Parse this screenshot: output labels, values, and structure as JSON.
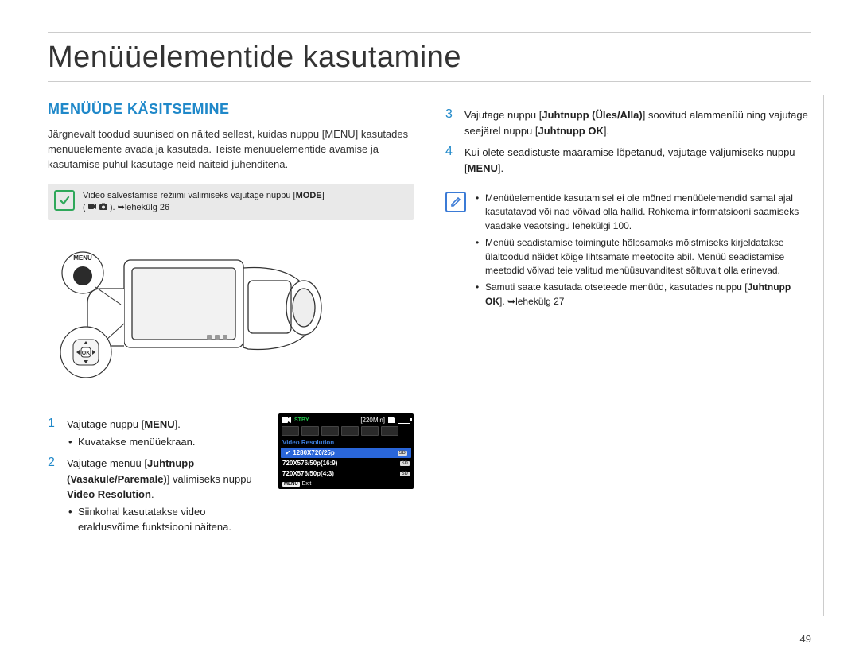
{
  "page": {
    "title": "Menüüelementide kasutamine",
    "number": "49"
  },
  "left": {
    "subhead": "MENÜÜDE KÄSITSEMINE",
    "intro": "Järgnevalt toodud suunised on näited sellest, kuidas nuppu [MENU] kasutades menüüelemente avada ja kasutada. Teiste menüüelementide avamise ja kasutamise puhul kasutage neid näiteid juhenditena.",
    "note": {
      "text_a": "Video salvestamise režiimi valimiseks vajutage nuppu [",
      "mode": "MODE",
      "text_b": "]",
      "page_ref": "lehekülg 26"
    },
    "camera_labels": {
      "menu": "MENU",
      "ok": "OK"
    },
    "steps": {
      "s1": {
        "num": "1",
        "line": "Vajutage nuppu [MENU].",
        "bullet": "Kuvatakse menüüekraan."
      },
      "s2": {
        "num": "2",
        "line_a": "Vajutage menüü [",
        "ctrl": "Juhtnupp (Vasakule/Paremale)",
        "line_b": "] valimiseks nuppu ",
        "target": "Video Resolution",
        "line_c": ".",
        "bullet": "Siinkohal kasutatakse video eraldusvõime funktsiooni näitena."
      }
    },
    "lcd": {
      "stby": "STBY",
      "time": "[220Min]",
      "title": "Video Resolution",
      "rows": [
        "1280X720/25p",
        "720X576/50p(16:9)",
        "720X576/50p(4:3)"
      ],
      "sd": "SD",
      "menu_chip": "MENU",
      "exit": "Exit"
    }
  },
  "right": {
    "steps": {
      "s3": {
        "num": "3",
        "a": "Vajutage nuppu [",
        "ctrl": "Juhtnupp (Üles/Alla)",
        "b": "] soovitud alammenüü ning vajutage seejärel nuppu  [",
        "ok": "Juhtnupp OK",
        "c": "]."
      },
      "s4": {
        "num": "4",
        "a": "Kui olete seadistuste määramise lõpetanud, vajutage väljumiseks nuppu [",
        "menu": "MENU",
        "b": "]."
      }
    },
    "info": {
      "b1": "Menüüelementide kasutamisel ei ole mõned menüüelemendid samal ajal kasutatavad või nad võivad olla hallid. Rohkema informatsiooni saamiseks vaadake veaotsingu lehekülgi 100.",
      "b2": "Menüü seadistamise toimingute hõlpsamaks mõistmiseks kirjeldatakse ülaltoodud näidet kõige lihtsamate meetodite abil. Menüü seadistamise meetodid võivad teie valitud menüüsuvanditest sõltuvalt olla erinevad.",
      "b3_a": "Samuti saate kasutada otseteede menüüd, kasutades nuppu [",
      "b3_ok": "Juhtnupp OK",
      "b3_b": "]. ",
      "b3_ref": "lehekülg 27"
    }
  }
}
